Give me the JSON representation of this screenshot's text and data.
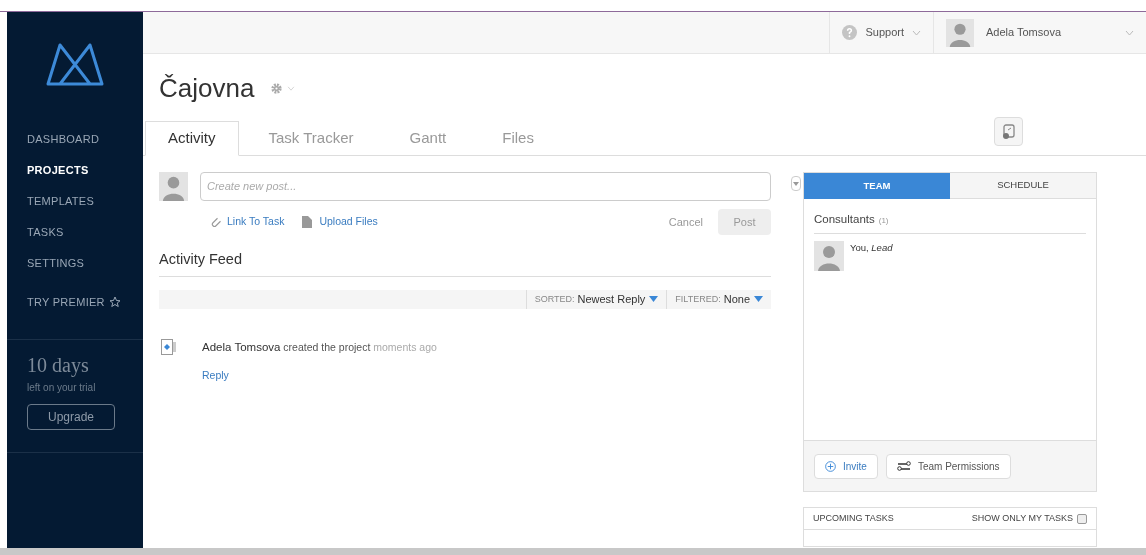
{
  "sidebar": {
    "nav": [
      {
        "label": "DASHBOARD",
        "selected": false
      },
      {
        "label": "PROJECTS",
        "selected": true
      },
      {
        "label": "TEMPLATES",
        "selected": false
      },
      {
        "label": "TASKS",
        "selected": false
      },
      {
        "label": "SETTINGS",
        "selected": false
      }
    ],
    "premier": "TRY PREMIER",
    "trial": {
      "days": "10 days",
      "note": "left on your trial",
      "button": "Upgrade"
    }
  },
  "header": {
    "support": "Support",
    "user": "Adela Tomsova"
  },
  "project": {
    "title": "Čajovna"
  },
  "tabs": [
    {
      "label": "Activity",
      "selected": true
    },
    {
      "label": "Task Tracker",
      "selected": false
    },
    {
      "label": "Gantt",
      "selected": false
    },
    {
      "label": "Files",
      "selected": false
    }
  ],
  "composer": {
    "placeholder": "Create new post...",
    "link_task": "Link To Task",
    "upload": "Upload Files",
    "cancel": "Cancel",
    "post": "Post",
    "post_disabled": true
  },
  "feed": {
    "title": "Activity Feed",
    "sorted_label": "SORTED:",
    "sorted": "Newest Reply",
    "filtered_label": "FILTERED:",
    "filtered": "None",
    "items": [
      {
        "author": "Adela Tomsova",
        "action": "created the project",
        "time": "moments ago",
        "reply": "Reply"
      }
    ]
  },
  "team_panel": {
    "tabs": [
      {
        "label": "TEAM",
        "selected": true
      },
      {
        "label": "SCHEDULE",
        "selected": false
      }
    ],
    "group": "Consultants",
    "count": "(1)",
    "members": [
      {
        "name": "You,",
        "role": "Lead"
      }
    ],
    "invite": "Invite",
    "permissions": "Team Permissions"
  },
  "upcoming": {
    "title": "UPCOMING TASKS",
    "filter": "SHOW ONLY MY TASKS",
    "checked": false
  }
}
